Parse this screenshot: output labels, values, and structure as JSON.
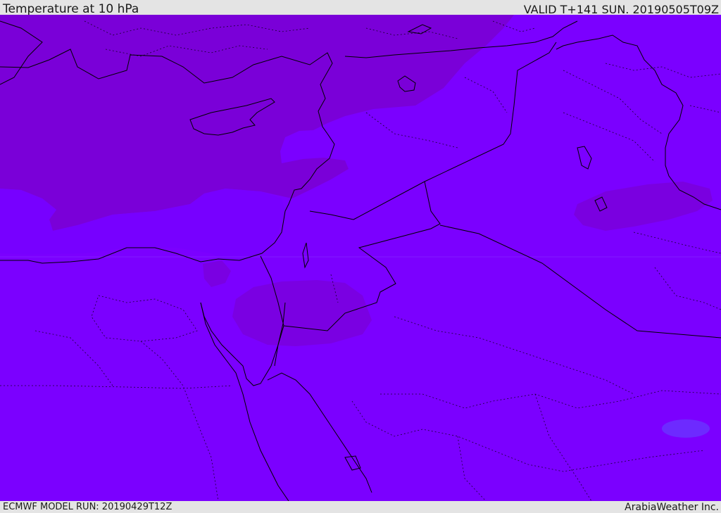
{
  "header": {
    "title": "Temperature at 10 hPa",
    "valid_time": "VALID T+141 SUN. 20190505T09Z"
  },
  "footer": {
    "model_run": "ECMWF MODEL RUN: 20190429T12Z",
    "brand": "ArabiaWeather Inc."
  },
  "colors": {
    "base_fill": "#7b00ff",
    "cold_region": "#7a00d8",
    "warm_spot": "#6d2aff",
    "border_line": "#000000",
    "header_bg": "#e4e4e4"
  }
}
